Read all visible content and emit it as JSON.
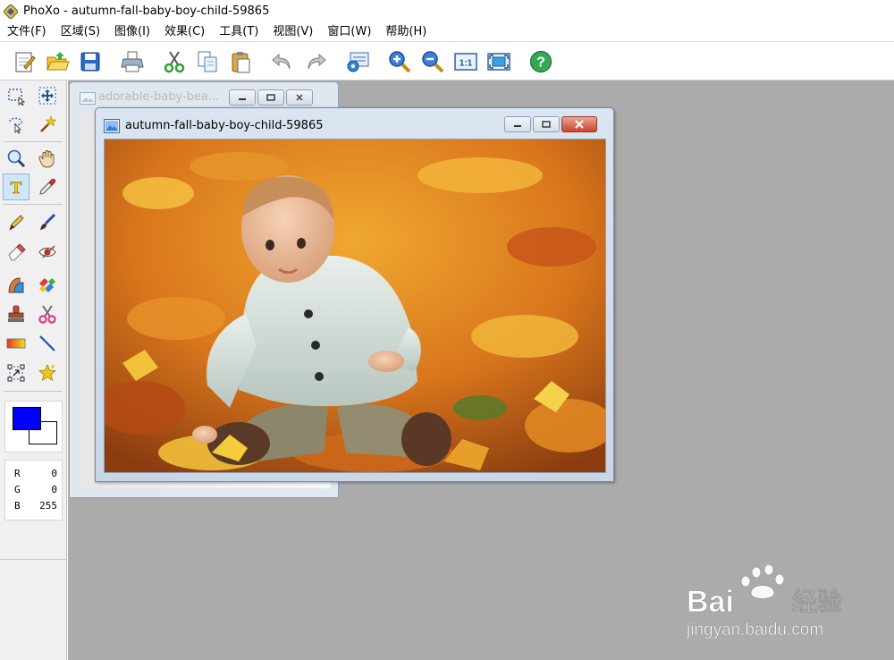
{
  "app": {
    "title": "PhoXo - autumn-fall-baby-boy-child-59865"
  },
  "menu": [
    {
      "label": "文件(F)"
    },
    {
      "label": "区域(S)"
    },
    {
      "label": "图像(I)"
    },
    {
      "label": "效果(C)"
    },
    {
      "label": "工具(T)"
    },
    {
      "label": "视图(V)"
    },
    {
      "label": "窗口(W)"
    },
    {
      "label": "帮助(H)"
    }
  ],
  "toolbar": {
    "buttons": [
      "new-icon",
      "open-icon",
      "save-icon",
      "print-icon",
      "cut-icon",
      "copy-icon",
      "paste-icon",
      "undo-icon",
      "redo-icon",
      "scan-icon",
      "zoom-in-icon",
      "zoom-out-icon",
      "actual-size-icon",
      "fit-window-icon",
      "help-icon"
    ],
    "actual_size_label": "1:1",
    "help_label": "?"
  },
  "toolbox": {
    "tools": [
      "rect-select-icon",
      "move-icon",
      "lasso-icon",
      "magic-wand-icon",
      "zoom-icon",
      "hand-icon",
      "text-icon",
      "eyedropper-icon",
      "pen-icon",
      "brush-icon",
      "eraser-icon",
      "red-eye-icon",
      "clone-icon",
      "color-replace-icon",
      "stamp-icon",
      "scissors-icon",
      "gradient-icon",
      "line-icon",
      "transform-icon",
      "star-icon"
    ],
    "selected_tool": "text-icon",
    "text_tool_label": "T",
    "foreground_color": "#0000ff",
    "background_color": "#ffffff",
    "rgb": [
      {
        "key": "R",
        "value": "0"
      },
      {
        "key": "G",
        "value": "0"
      },
      {
        "key": "B",
        "value": "255"
      }
    ]
  },
  "documents": {
    "back": {
      "title": "adorable-baby-bea..."
    },
    "front": {
      "title": "autumn-fall-baby-boy-child-59865"
    }
  },
  "watermark": {
    "brand": "Bai",
    "brand_tail": "经验",
    "url": "jingyan.baidu.com"
  },
  "colors": {
    "workspace": "#ababab",
    "accent": "#0000ff"
  }
}
